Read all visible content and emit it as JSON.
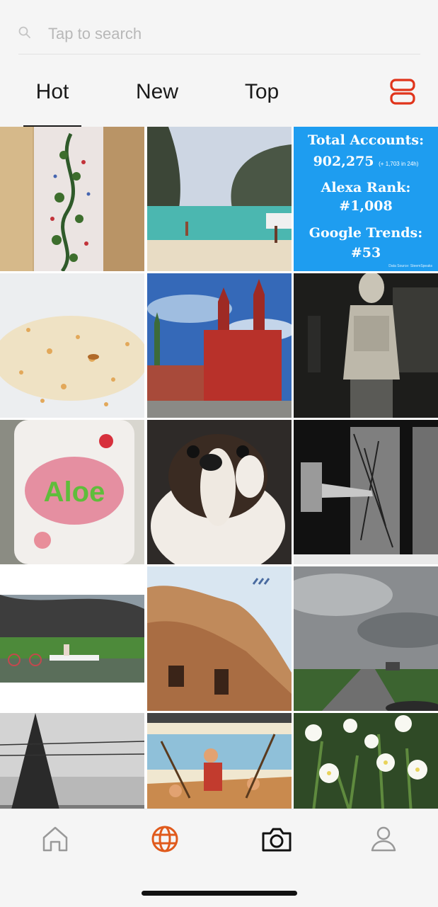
{
  "search": {
    "placeholder": "Tap to search",
    "icon": "search-icon"
  },
  "tabs": [
    {
      "label": "Hot",
      "active": true
    },
    {
      "label": "New",
      "active": false
    },
    {
      "label": "Top",
      "active": false
    }
  ],
  "layout_toggle": {
    "icon": "layout-toggle-icon",
    "color": "#e0341b"
  },
  "stats_card": {
    "line1": "Total Accounts:",
    "line2": "902,275",
    "line2_note": "(+ 1,703 in 24h)",
    "line3": "Alexa Rank:",
    "line4": "#1,008",
    "line5": "Google Trends:",
    "line6": "#53",
    "source": "Data Source: SteemSpeaks",
    "color": "#1e9df0"
  },
  "bottom_nav": [
    {
      "icon": "home-icon",
      "active": false
    },
    {
      "icon": "globe-icon",
      "active": true
    },
    {
      "icon": "camera-icon",
      "active": false
    },
    {
      "icon": "profile-icon",
      "active": false
    }
  ],
  "accent_color": "#e05a1c"
}
